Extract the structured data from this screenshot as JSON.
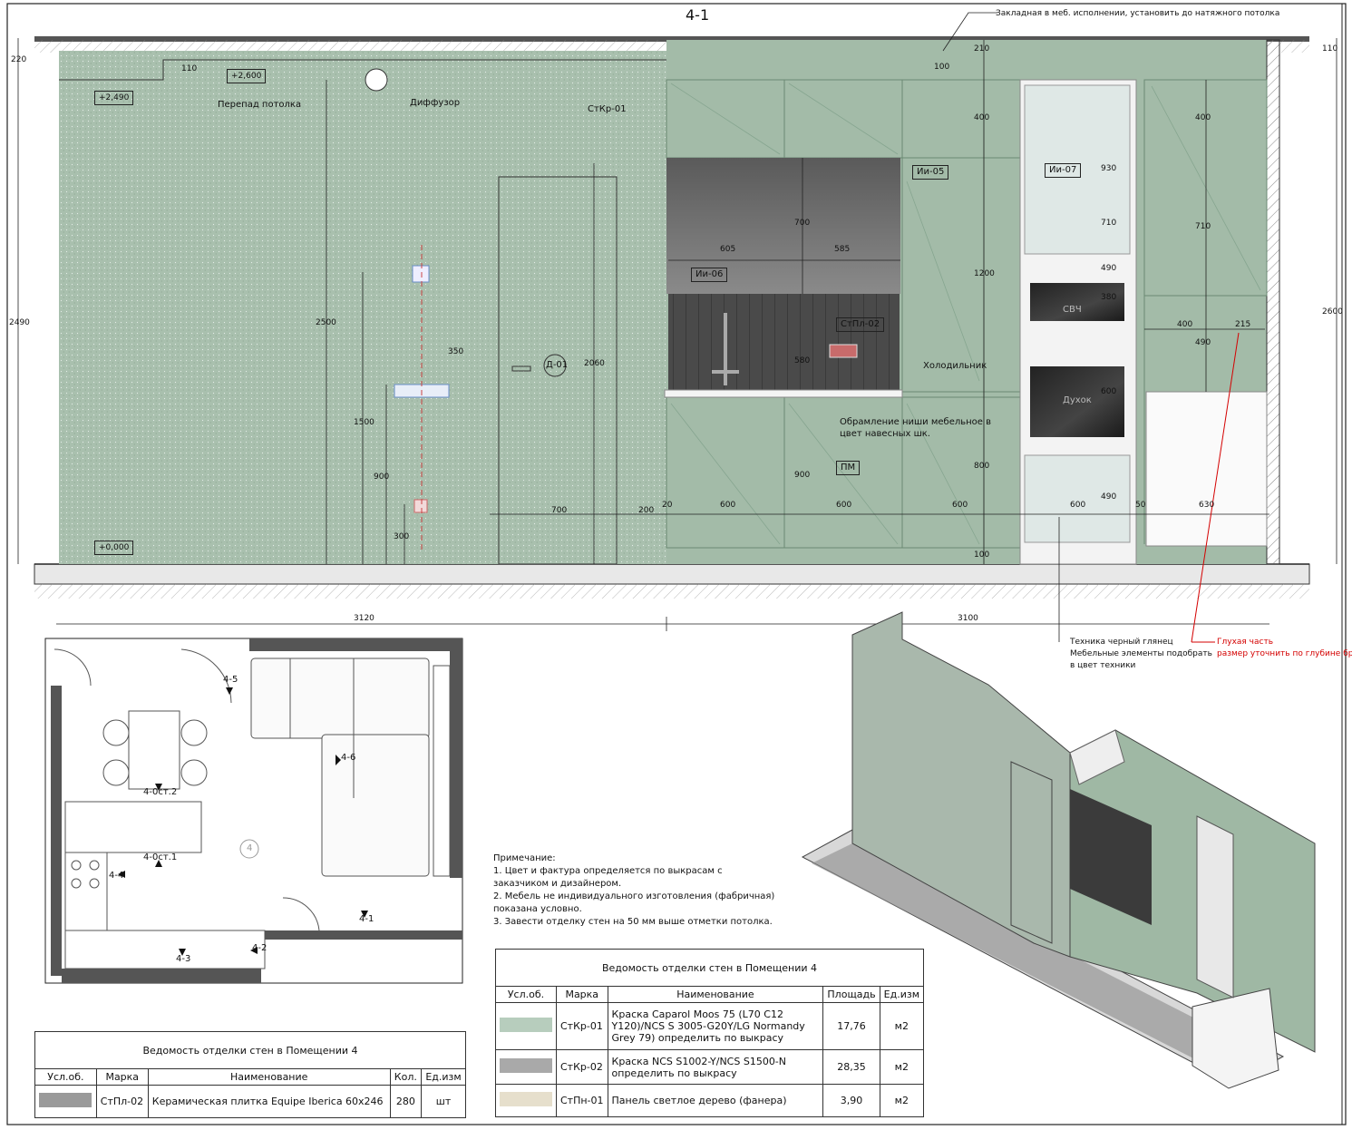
{
  "sheet": {
    "section_mark": "4-1",
    "top_callout": "Закладная в меб. исполнении, установить до натяжного потолка",
    "ceiling_step_note": "Перепад потолка",
    "diffuser_note": "Диффузор",
    "wall_finish_mark": "СтКр-01",
    "door_mark": "Д-01",
    "fridge_label": "Холодильник",
    "pm_label": "ПМ",
    "microwave_label": "СВЧ",
    "oven_label": "Духок",
    "niche_note_line1": "Обрамление ниши мебельное в",
    "niche_note_line2": "цвет навесных шк.",
    "appliance_note_line1": "Техника черный глянец",
    "appliance_note_line2": "Мебельные элементы подобрать",
    "appliance_note_line3": "в цвет техники",
    "blind_note_line1": "Глухая часть",
    "blind_note_line2": "размер уточнить по глубине бра",
    "level_marks": [
      "+2,490",
      "+2,600",
      "+0,000"
    ],
    "item_marks": [
      "Ии-05",
      "Ии-06",
      "Ии-07",
      "СтПл-02"
    ],
    "dims_top": [
      "220",
      "110",
      "100",
      "210",
      "110"
    ],
    "dims_left": [
      "2490",
      "2500",
      "1500",
      "900",
      "300"
    ],
    "dims_right": [
      "2600"
    ],
    "dims_misc": [
      "350",
      "2060",
      "700",
      "200",
      "20",
      "600",
      "600",
      "600",
      "600",
      "50",
      "630",
      "605",
      "585",
      "700",
      "580",
      "900",
      "800",
      "100",
      "400",
      "1200",
      "930",
      "710",
      "490",
      "380",
      "600",
      "490",
      "400",
      "215",
      "400",
      "710",
      "490"
    ],
    "dims_bottom": [
      "3120",
      "3100"
    ]
  },
  "plan": {
    "room_number": "4",
    "marks": [
      "4-5",
      "4-6",
      "4-0ст.2",
      "4-0ст.1",
      "4-4",
      "4-3",
      "4-2",
      "4-1"
    ]
  },
  "notes": {
    "title": "Примечание:",
    "lines": [
      "1. Цвет и фактура определяется по выкрасам с",
      "   заказчиком и дизайнером.",
      "2. Мебель не индивидуального изготовления (фабричная)",
      "   показана условно.",
      "3. Завести отделку стен на 50 мм выше отметки потолка."
    ]
  },
  "schedule_tiles": {
    "caption": "Ведомость отделки стен в Помещении 4",
    "headers": [
      "Усл.об.",
      "Марка",
      "Наименование",
      "Кол.",
      "Ед.изм"
    ],
    "rows": [
      {
        "swatch": "#9a9a9a",
        "mark": "СтПл-02",
        "name": "Керамическая плитка Equipe Iberica 60x246",
        "qty": "280",
        "unit": "шт"
      }
    ]
  },
  "schedule_walls": {
    "caption": "Ведомость отделки стен в Помещении 4",
    "headers": [
      "Усл.об.",
      "Марка",
      "Наименование",
      "Площадь",
      "Ед.изм"
    ],
    "rows": [
      {
        "swatch": "#b7cdbd",
        "mark": "СтКр-01",
        "name": "Краска Caparol Moos 75 (L70 C12 Y120)/NCS S 3005-G20Y/LG Normandy Grey 79) определить по выкрасу",
        "qty": "17,76",
        "unit": "м2"
      },
      {
        "swatch": "#a9a9a9",
        "mark": "СтКр-02",
        "name": "Краска NCS S1002-Y/NCS S1500-N определить по выкрасу",
        "qty": "28,35",
        "unit": "м2"
      },
      {
        "swatch": "#e6dfcc",
        "mark": "СтПн-01",
        "name": "Панель светлое дерево (фанера)",
        "qty": "3,90",
        "unit": "м2"
      }
    ]
  },
  "colors": {
    "wall_left": "#a9c0ae",
    "wall_right": "#a3bba8",
    "furniture_lines": "#6b8a73",
    "niche_dark": "#3a3a3a",
    "accent_red": "#d40000"
  }
}
